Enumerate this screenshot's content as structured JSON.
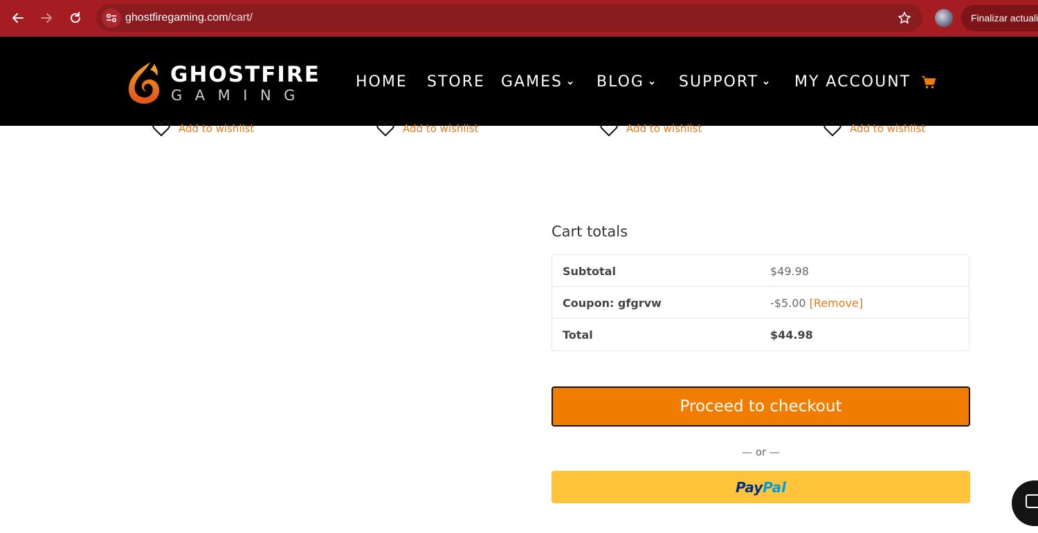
{
  "browser": {
    "url_host": "ghostfiregaming.com",
    "url_path": "/cart/",
    "update_button_label": "Finalizar actualiz"
  },
  "header": {
    "logo": {
      "line1": "GHOSTFIRE",
      "line2": "GAMING"
    },
    "nav": [
      {
        "label": "HOME",
        "has_dropdown": false
      },
      {
        "label": "STORE",
        "has_dropdown": false
      },
      {
        "label": "GAMES",
        "has_dropdown": true
      },
      {
        "label": "BLOG",
        "has_dropdown": true
      },
      {
        "label": "SUPPORT",
        "has_dropdown": true
      },
      {
        "label": "MY ACCOUNT",
        "has_dropdown": false
      }
    ],
    "accent_color": "#f07c00"
  },
  "wishlist_links": [
    "Add to wishlist",
    "Add to wishlist",
    "Add to wishlist",
    "Add to wishlist"
  ],
  "cart_totals": {
    "title": "Cart totals",
    "rows": [
      {
        "label": "Subtotal",
        "value": "$49.98"
      },
      {
        "label": "Coupon: gfgrvw",
        "value": "-$5.00",
        "action": "[Remove]"
      },
      {
        "label": "Total",
        "value": "$44.98"
      }
    ],
    "checkout_label": "Proceed to checkout",
    "or_label": "— or —",
    "paypal": {
      "part1": "Pay",
      "part2": "Pal"
    }
  }
}
